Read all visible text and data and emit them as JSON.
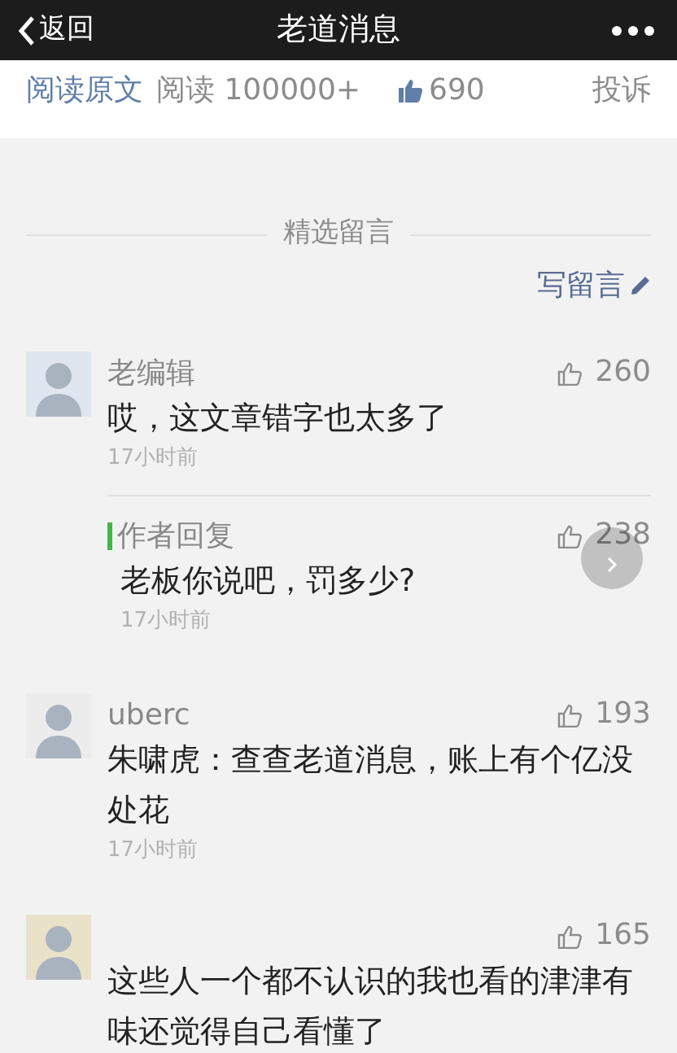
{
  "nav": {
    "back": "返回",
    "title": "老道消息"
  },
  "stats": {
    "read_original": "阅读原文",
    "reads": "阅读 100000+",
    "likes": "690",
    "report": "投诉"
  },
  "section_title": "精选留言",
  "write_comment": "写留言",
  "comments": [
    {
      "name": "老编辑",
      "likes": "260",
      "text": "哎，这文章错字也太多了",
      "time": "17小时前",
      "reply": {
        "label": "作者回复",
        "likes": "238",
        "text": "老板你说吧，罚多少?",
        "time": "17小时前"
      }
    },
    {
      "name": "uberc",
      "likes": "193",
      "text": "朱啸虎：查查老道消息，账上有个亿没处花",
      "time": "17小时前"
    },
    {
      "likes": "165",
      "text": "这些人一个都不认识的我也看的津津有味还觉得自己看懂了"
    }
  ]
}
